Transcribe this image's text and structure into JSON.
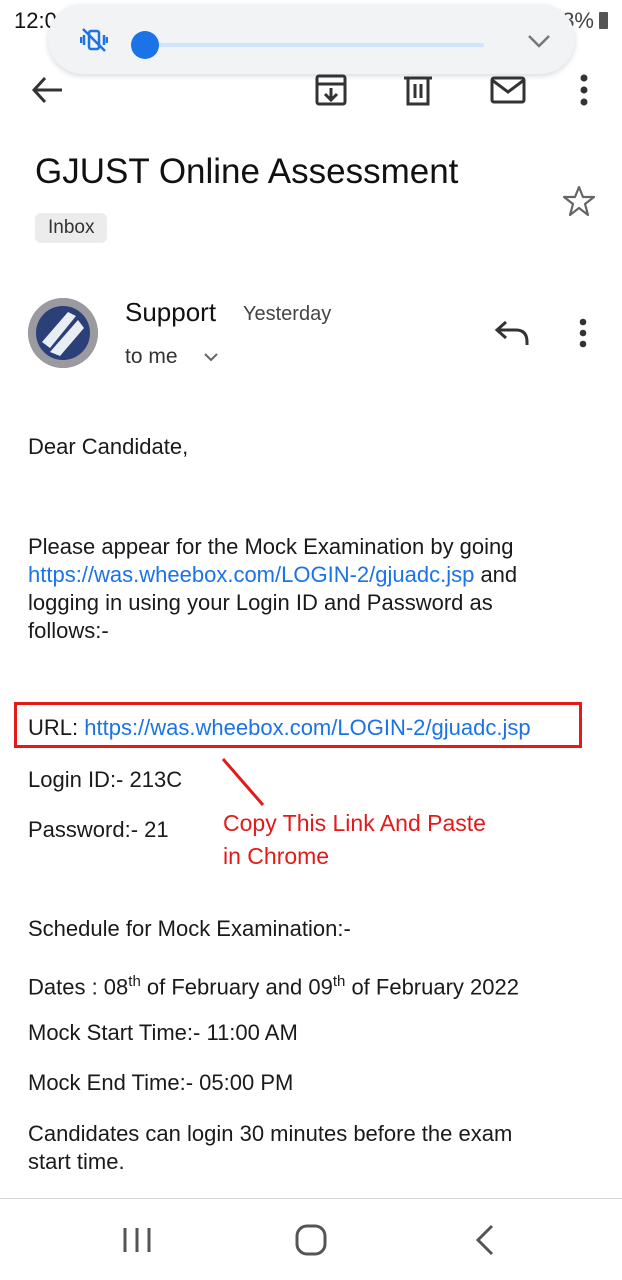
{
  "status_bar": {
    "time": "12:02",
    "battery": "73%"
  },
  "volume_overlay": {
    "mute_icon": "vibrate-muted-icon",
    "expand_icon": "chevron-down-icon"
  },
  "toolbar": {
    "back_icon": "arrow-left-icon",
    "archive_icon": "archive-icon",
    "delete_icon": "trash-icon",
    "mark_unread_icon": "mail-icon",
    "more_icon": "more-vert-icon"
  },
  "email": {
    "subject": "GJUST Online Assessment",
    "label": "Inbox",
    "sender": "Support",
    "time": "Yesterday",
    "recipient": "to me",
    "greeting": "Dear Candidate,",
    "para1_pre": "Please appear for the Mock Examination by going",
    "para1_link": "https://was.wheebox.com/LOGIN-2/gjuadc.jsp",
    "para1_post1": " and",
    "para1_post2": "logging in using your Login ID and Password as",
    "para1_post3": "follows:-",
    "url_label": "URL: ",
    "url_link": "https://was.wheebox.com/LOGIN-2/gjuadc.jsp",
    "login_id": "Login ID:- 213C",
    "password": "Password:- 21",
    "schedule_heading": "Schedule for Mock Examination:-",
    "dates_pre": "Dates : 08",
    "dates_sup1": "th",
    "dates_mid": " of February and 09",
    "dates_sup2": "th",
    "dates_post": " of February 2022",
    "start_time": "Mock Start Time:- 11:00 AM",
    "end_time": "Mock End Time:- 05:00 PM",
    "login_note1": "Candidates can login 30 minutes before the exam",
    "login_note2": "start time."
  },
  "annotation": {
    "line1": "Copy This Link And Paste",
    "line2": "in Chrome"
  },
  "nav_bar": {
    "recents_icon": "recents-icon",
    "home_icon": "home-icon",
    "back_icon": "back-chevron-icon"
  },
  "colors": {
    "link": "#1a73e8",
    "annotation": "#e31a1a",
    "volume_accent": "#1a73e8"
  }
}
